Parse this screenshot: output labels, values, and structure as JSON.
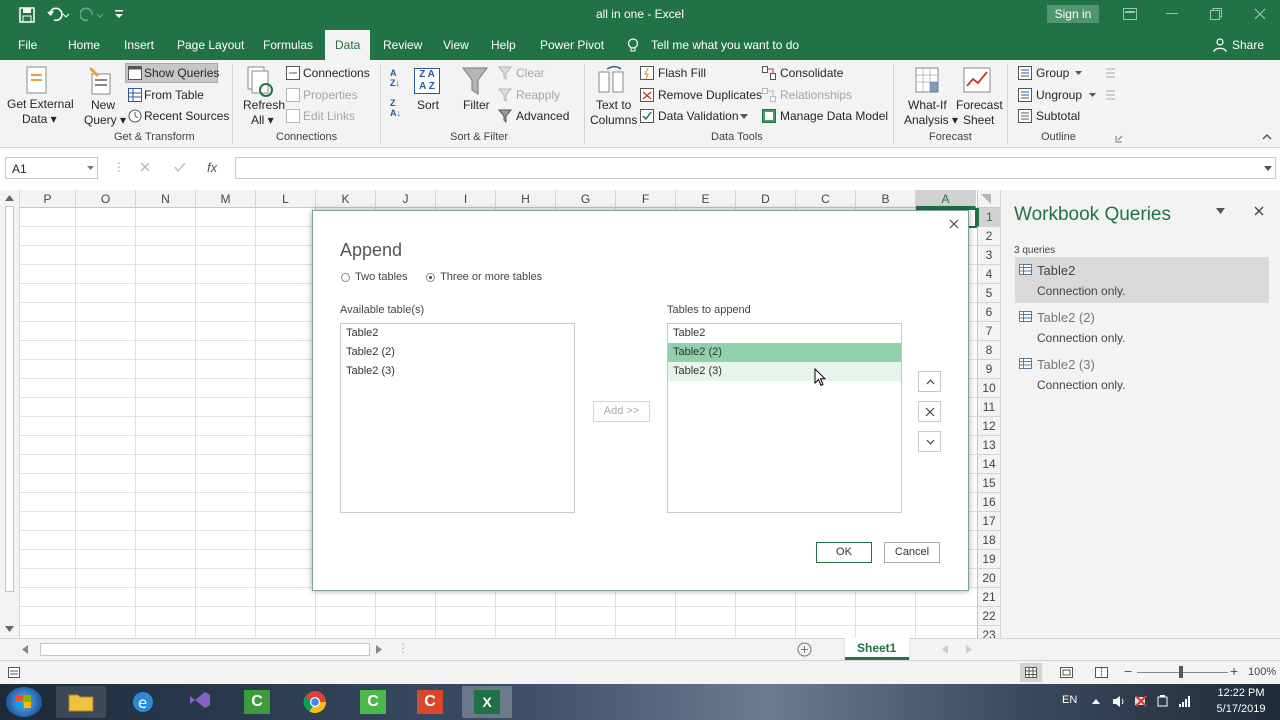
{
  "window": {
    "title": "all in one  -  Excel",
    "signin": "Sign in"
  },
  "tabs": [
    "File",
    "Home",
    "Insert",
    "Page Layout",
    "Formulas",
    "Data",
    "Review",
    "View",
    "Help",
    "Power Pivot"
  ],
  "tellme": "Tell me what you want to do",
  "share": "Share",
  "ribbon": {
    "get_external_1": "Get External",
    "get_external_2": "Data ▾",
    "new_query_1": "New",
    "new_query_2": "Query ▾",
    "show_queries": "Show Queries",
    "from_table": "From Table",
    "recent_sources": "Recent Sources",
    "grp_get_transform": "Get & Transform",
    "refresh_1": "Refresh",
    "refresh_2": "All ▾",
    "connections": "Connections",
    "properties": "Properties",
    "edit_links": "Edit Links",
    "grp_connections": "Connections",
    "sort": "Sort",
    "filter": "Filter",
    "clear": "Clear",
    "reapply": "Reapply",
    "advanced": "Advanced",
    "grp_sort_filter": "Sort & Filter",
    "text_to_columns_1": "Text to",
    "text_to_columns_2": "Columns",
    "flash_fill": "Flash Fill",
    "remove_duplicates": "Remove Duplicates",
    "data_validation": "Data Validation",
    "consolidate": "Consolidate",
    "relationships": "Relationships",
    "manage_data_model": "Manage Data Model",
    "grp_data_tools": "Data Tools",
    "whatif_1": "What-If",
    "whatif_2": "Analysis ▾",
    "forecast_1": "Forecast",
    "forecast_2": "Sheet",
    "grp_forecast": "Forecast",
    "group": "Group",
    "ungroup": "Ungroup",
    "subtotal": "Subtotal",
    "grp_outline": "Outline"
  },
  "formula_bar": {
    "name_box": "A1",
    "fx": "fx",
    "formula": ""
  },
  "columns": [
    "P",
    "O",
    "N",
    "M",
    "L",
    "K",
    "J",
    "I",
    "H",
    "G",
    "F",
    "E",
    "D",
    "C",
    "B",
    "A"
  ],
  "rows": [
    "1",
    "2",
    "3",
    "4",
    "5",
    "6",
    "7",
    "8",
    "9",
    "10",
    "11",
    "12",
    "13",
    "14",
    "15",
    "16",
    "17",
    "18",
    "19",
    "20",
    "21",
    "22",
    "23"
  ],
  "panel": {
    "title": "Workbook Queries",
    "count": "3 queries",
    "queries": [
      {
        "name": "Table2",
        "status": "Connection only."
      },
      {
        "name": "Table2 (2)",
        "status": "Connection only."
      },
      {
        "name": "Table2 (3)",
        "status": "Connection only."
      }
    ]
  },
  "dialog": {
    "title": "Append",
    "opt_two": "Two tables",
    "opt_three": "Three or more tables",
    "available_label": "Available table(s)",
    "available": [
      "Table2",
      "Table2 (2)",
      "Table2 (3)"
    ],
    "append_label": "Tables to append",
    "append": [
      "Table2",
      "Table2 (2)",
      "Table2 (3)"
    ],
    "add_btn": "Add >>",
    "ok": "OK",
    "cancel": "Cancel",
    "accent": "#8fd1ab"
  },
  "sheet_tab": "Sheet1",
  "zoom": "100%",
  "tray": {
    "lang": "EN",
    "time": "12:22 PM",
    "date": "5/17/2019"
  }
}
